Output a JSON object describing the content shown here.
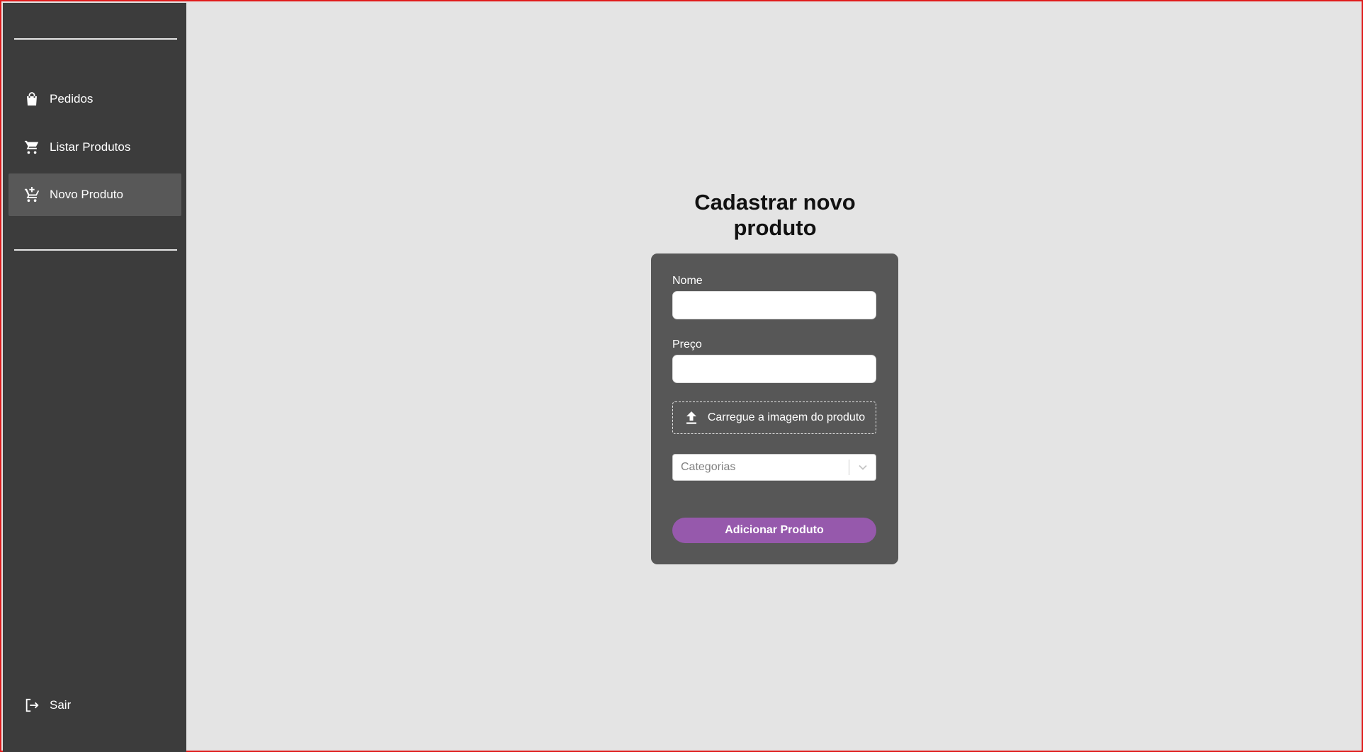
{
  "sidebar": {
    "items": [
      {
        "label": "Pedidos",
        "icon": "shopping-bag-icon"
      },
      {
        "label": "Listar Produtos",
        "icon": "shopping-cart-icon"
      },
      {
        "label": "Novo Produto",
        "icon": "add-shopping-cart-icon",
        "active": true
      }
    ],
    "logout": {
      "label": "Sair",
      "icon": "logout-icon"
    }
  },
  "main": {
    "title": "Cadastrar novo produto",
    "form": {
      "name_label": "Nome",
      "name_value": "",
      "price_label": "Preço",
      "price_value": "",
      "upload_label": "Carregue a imagem do produto",
      "upload_icon": "upload-icon",
      "categories_placeholder": "Categorias",
      "submit_label": "Adicionar Produto"
    }
  },
  "colors": {
    "sidebar_bg": "#3c3c3c",
    "sidebar_active": "#585858",
    "card_bg": "#575757",
    "page_bg": "#e4e4e4",
    "accent": "#9659ac",
    "frame_border": "#e01b1b"
  }
}
